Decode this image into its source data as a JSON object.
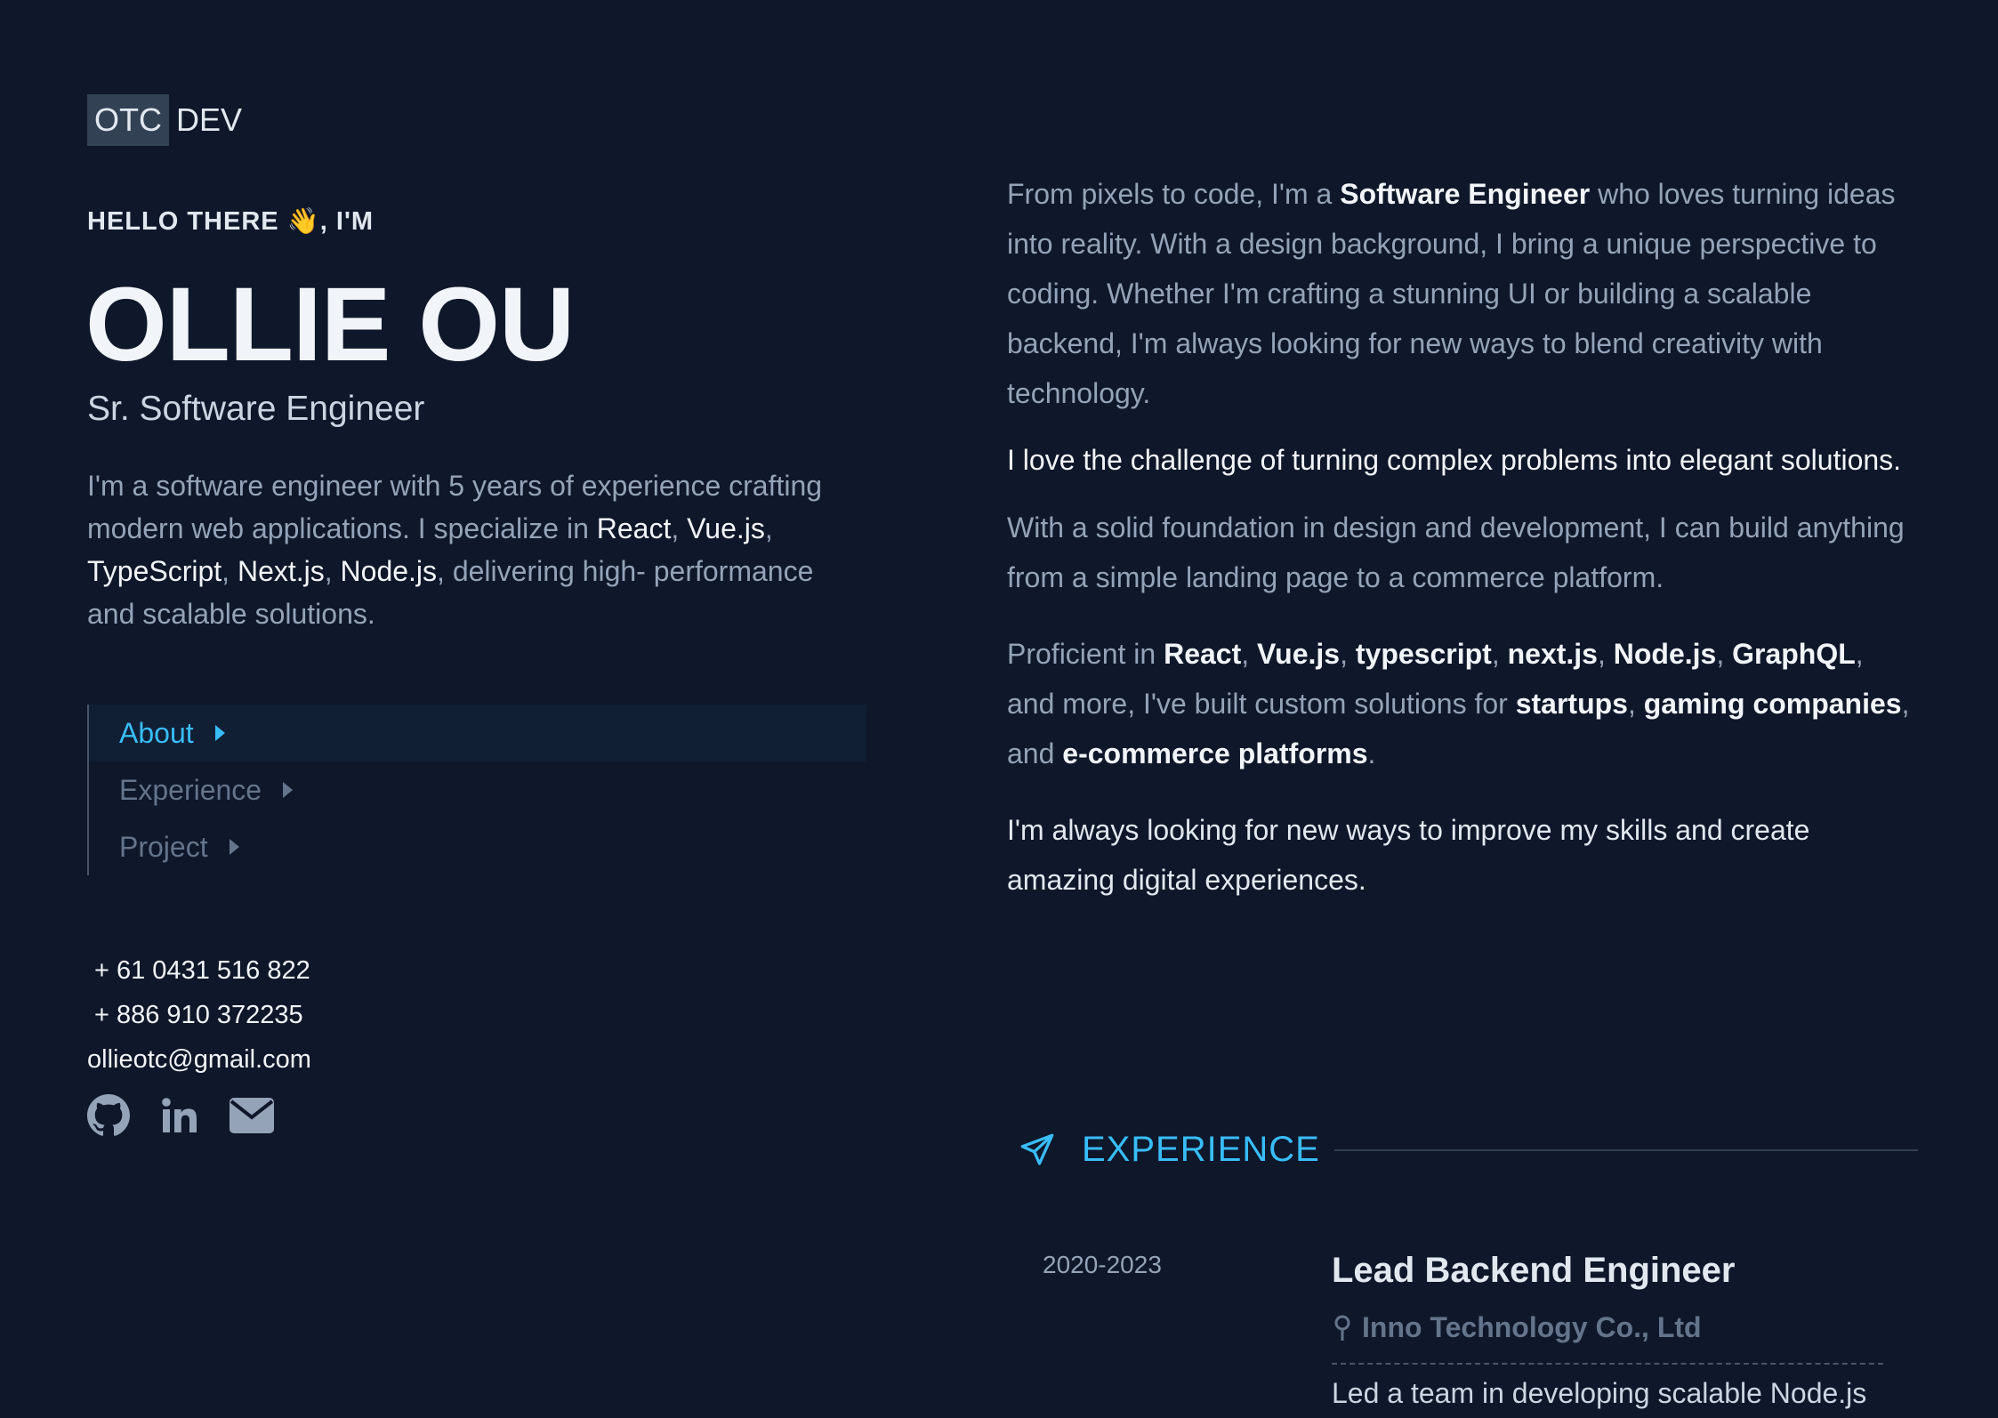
{
  "logo": {
    "box": "OTC",
    "rest": "DEV"
  },
  "hero": {
    "greeting": "HELLO THERE 👋, I'M",
    "name": "OLLIE OU",
    "role": "Sr. Software Engineer",
    "bio": {
      "intro": "I'm a software engineer with 5 years of experience crafting modern web applications. I specialize in ",
      "tech1": "React",
      "sep1": ", ",
      "tech2": "Vue.js",
      "sep2": ", ",
      "tech3": "TypeScript",
      "sep3": ", ",
      "tech4": "Next.js",
      "sep4": ", ",
      "tech5": "Node.js",
      "outro": ", delivering high- performance and scalable solutions."
    }
  },
  "nav": {
    "items": [
      {
        "label": "About",
        "active": true
      },
      {
        "label": "Experience",
        "active": false
      },
      {
        "label": "Project",
        "active": false
      }
    ]
  },
  "contact": {
    "phone1": "+ 61 0431 516 822",
    "phone2": "+ 886 910 372235",
    "email": "ollieotc@gmail.com"
  },
  "socials": [
    "github-icon",
    "linkedin-icon",
    "mail-icon"
  ],
  "about": {
    "p1": {
      "a": "From pixels to code, I'm a ",
      "b": "Software Engineer",
      "c": " who loves turning ideas into reality. With a design background, I bring a unique perspective to coding. Whether I'm crafting a stunning UI or building a scalable backend, I'm always looking for new ways to blend creativity with technology."
    },
    "p2": "I love the challenge of turning complex problems into elegant solutions.",
    "p3": "With a solid foundation in design and development, I can build anything from a simple landing page to a commerce platform.",
    "p4": {
      "a": "Proficient in ",
      "t1": "React",
      "s1": ", ",
      "t2": "Vue.js",
      "s2": ", ",
      "t3": "typescript",
      "s3": ", ",
      "t4": "next.js",
      "s4": ", ",
      "t5": "Node.js",
      "s5": ", ",
      "t6": "GraphQL",
      "b": ", and more, I've built custom solutions for ",
      "c1": "startups",
      "s6": ", ",
      "c2": "gaming companies",
      "s7": ", and ",
      "c3": "e-commerce platforms",
      "end": "."
    },
    "p5": "I'm always looking for new ways to improve my skills and create amazing digital experiences."
  },
  "experience": {
    "heading": "EXPERIENCE",
    "job": {
      "years": "2020-2023",
      "title": "Lead Backend Engineer",
      "company": "Inno Technology Co., Ltd",
      "desc": "Led a team in developing scalable Node.js"
    }
  },
  "colors": {
    "background": "#0f172a",
    "accent": "#38bdf8",
    "muted": "#94a3b8"
  }
}
